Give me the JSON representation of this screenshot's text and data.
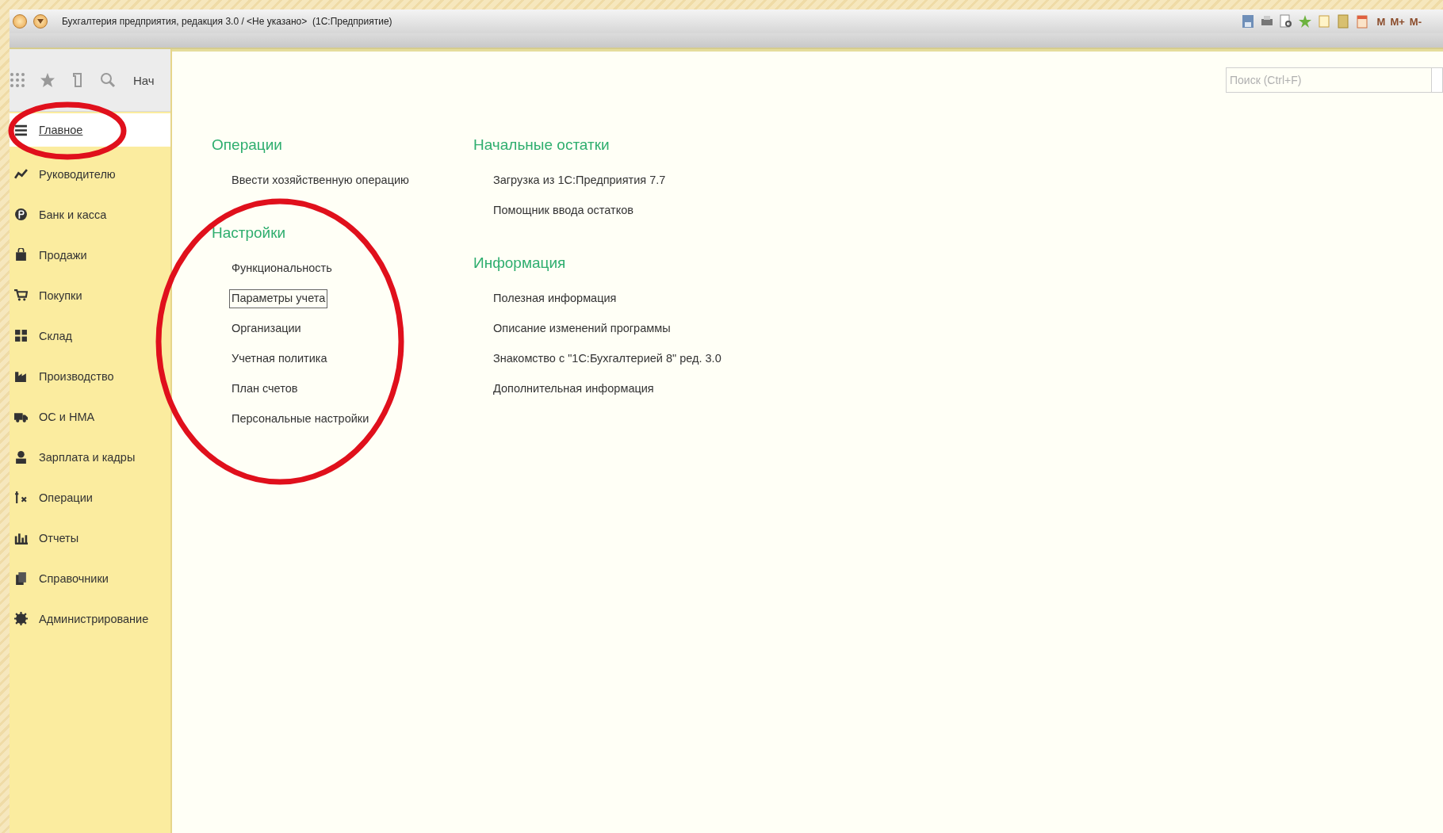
{
  "window": {
    "title": "Бухгалтерия предприятия, редакция 3.0 / <Не указано>  (1С:Предприятие)",
    "memory_buttons": [
      "M",
      "M+",
      "M-"
    ]
  },
  "toolbar": {
    "tab_label": "Нач"
  },
  "sidebar": {
    "items": [
      {
        "label": "Главное",
        "selected": true
      },
      {
        "label": "Руководителю",
        "selected": false
      },
      {
        "label": "Банк и касса",
        "selected": false
      },
      {
        "label": "Продажи",
        "selected": false
      },
      {
        "label": "Покупки",
        "selected": false
      },
      {
        "label": "Склад",
        "selected": false
      },
      {
        "label": "Производство",
        "selected": false
      },
      {
        "label": "ОС и НМА",
        "selected": false
      },
      {
        "label": "Зарплата и кадры",
        "selected": false
      },
      {
        "label": "Операции",
        "selected": false
      },
      {
        "label": "Отчеты",
        "selected": false
      },
      {
        "label": "Справочники",
        "selected": false
      },
      {
        "label": "Администрирование",
        "selected": false
      }
    ]
  },
  "search": {
    "placeholder": "Поиск (Ctrl+F)"
  },
  "columns": [
    [
      {
        "heading": "Операции",
        "links": [
          {
            "label": "Ввести хозяйственную операцию",
            "focused": false
          }
        ]
      },
      {
        "heading": "Настройки",
        "links": [
          {
            "label": "Функциональность",
            "focused": false
          },
          {
            "label": "Параметры учета",
            "focused": true
          },
          {
            "label": "Организации",
            "focused": false
          },
          {
            "label": "Учетная политика",
            "focused": false
          },
          {
            "label": "План счетов",
            "focused": false
          },
          {
            "label": "Персональные настройки",
            "focused": false
          }
        ]
      }
    ],
    [
      {
        "heading": "Начальные остатки",
        "links": [
          {
            "label": "Загрузка из 1С:Предприятия 7.7",
            "focused": false
          },
          {
            "label": "Помощник ввода остатков",
            "focused": false
          }
        ]
      },
      {
        "heading": "Информация",
        "links": [
          {
            "label": "Полезная информация",
            "focused": false
          },
          {
            "label": "Описание изменений программы",
            "focused": false
          },
          {
            "label": "Знакомство с \"1С:Бухгалтерией 8\" ред. 3.0",
            "focused": false
          },
          {
            "label": "Дополнительная информация",
            "focused": false
          }
        ]
      }
    ]
  ],
  "highlight_marks": [
    {
      "kind": "ellipse",
      "color": "#e0101c"
    },
    {
      "kind": "ellipse",
      "color": "#e0101c"
    }
  ]
}
